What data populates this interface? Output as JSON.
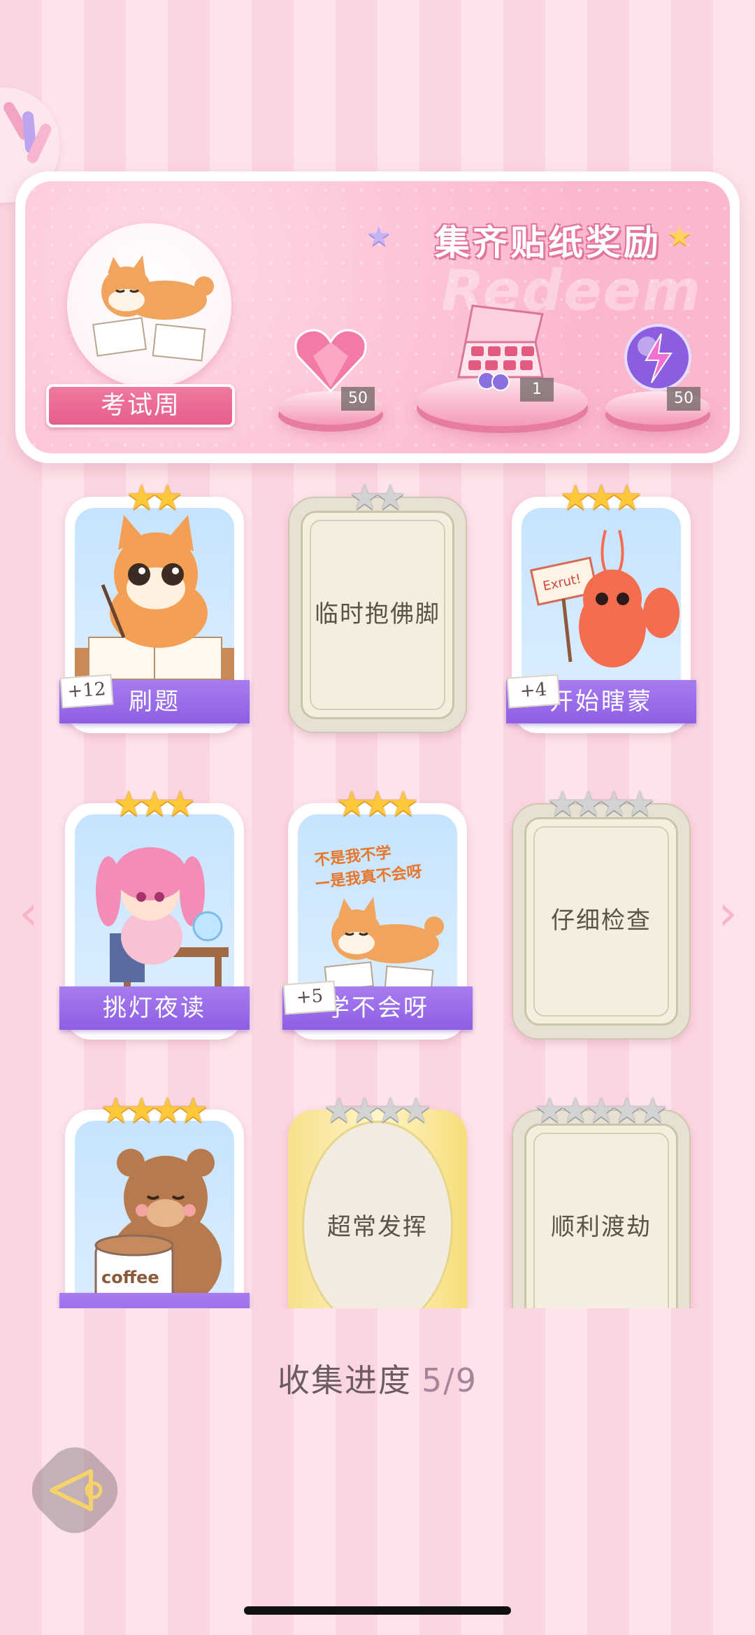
{
  "banner": {
    "title": "集齐贴纸奖励",
    "watermark": "Redeem",
    "deck_label": "考试周",
    "rewards": [
      {
        "item": "pink-heart-gem-icon",
        "count": "50"
      },
      {
        "item": "gift-box-icon",
        "count": "1"
      },
      {
        "item": "purple-lightning-orb-icon",
        "count": "50"
      }
    ]
  },
  "cards": [
    {
      "label": "刷题",
      "state": "collected",
      "plus": "+12",
      "stars_on": 2,
      "stars_total": 2,
      "art": "cat-writing"
    },
    {
      "label": "临时抱佛脚",
      "state": "locked",
      "stars_on": 0,
      "stars_total": 2
    },
    {
      "label": "开始瞎蒙",
      "state": "collected",
      "plus": "+4",
      "stars_on": 3,
      "stars_total": 3,
      "art": "shrimp-sign",
      "sign_text": "Exrut!"
    },
    {
      "label": "挑灯夜读",
      "state": "collected",
      "stars_on": 3,
      "stars_total": 3,
      "art": "girl-studying"
    },
    {
      "label": "学不会呀",
      "state": "collected",
      "plus": "+5",
      "stars_on": 3,
      "stars_total": 3,
      "art": "shiba",
      "art_text_1": "不是我不学",
      "art_text_2": "—是我真不会呀"
    },
    {
      "label": "仔细检查",
      "state": "locked",
      "stars_on": 0,
      "stars_total": 4
    },
    {
      "label": "",
      "state": "collected",
      "stars_on": 4,
      "stars_total": 4,
      "art": "bear-coffee",
      "cup_text": "coffee"
    },
    {
      "label": "超常发挥",
      "state": "locked-gold",
      "stars_on": 0,
      "stars_total": 4
    },
    {
      "label": "顺利渡劫",
      "state": "locked",
      "stars_on": 0,
      "stars_total": 5
    }
  ],
  "progress": {
    "label": "收集进度",
    "value": "5/9"
  },
  "nav": {
    "prev": "‹",
    "next": "›"
  },
  "colors": {
    "ribbon": "#9a6ce8",
    "star_on": "#ffc83a",
    "star_off": "#d3d3d3",
    "accent_pink": "#e45f8a"
  }
}
